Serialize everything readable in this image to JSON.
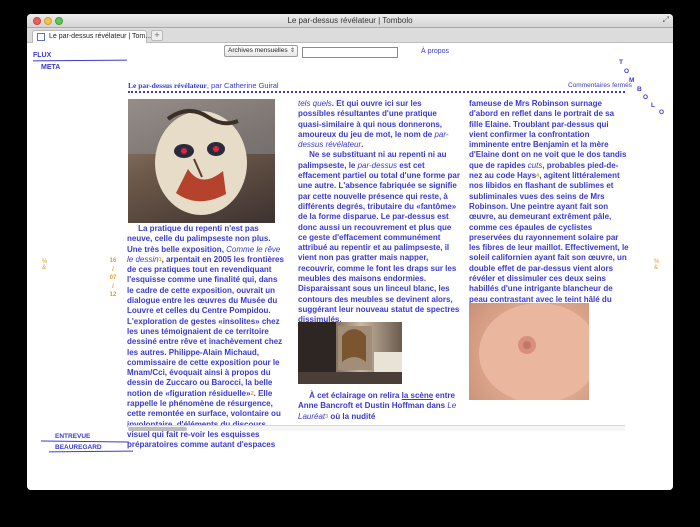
{
  "window": {
    "title": "Le par-dessus révélateur | Tombolo"
  },
  "tabs": [
    {
      "label": "Le par-dessus révélateur | Tom..."
    }
  ],
  "nav": {
    "flux": "FLUX",
    "meta": "META",
    "entrevue": "ENTREVUE",
    "beauregard": "BEAUREGARD"
  },
  "toolbar": {
    "archive_label": "Archives mensuelles",
    "search_placeholder": "",
    "apropos": "À propos"
  },
  "logo": {
    "letters": [
      "T",
      "O",
      "M",
      "B",
      "O",
      "L",
      "O"
    ]
  },
  "post": {
    "headline": "Le par-dessus révélateur",
    "byline_prefix": ", par ",
    "author": "Catherine Guiral",
    "comments": "Commentaires fermés",
    "date": [
      "16",
      "/",
      "07",
      "/",
      "12"
    ]
  },
  "text": {
    "c1_a": "La pratique du repenti n'est pas neuve, celle du palimpseste non plus. Une très belle exposition, ",
    "c1_em1": "Comme le rêve le dessin",
    "c1_fn1": "1",
    "c1_b": ", arpentait en 2005 les frontières de ces pratiques tout en revendiquant l'esquisse comme une finalité qui, dans le cadre de cette exposition, ouvrait un dialogue entre les œuvres du Musée du Louvre et celles du Centre Pompidou. L'exploration de gestes «insolites» chez les unes témoignaient de ce territoire dessiné entre rêve et inachèvement chez les autres. Philippe-Alain Michaud, commissaire de cette exposition pour le Mnam/Cci, évoquait ainsi à propos du dessin de Zuccaro ou Barocci, la belle notion de «figuration résiduelle»",
    "c1_fn2": "2",
    "c1_c": ". Elle rappelle le phénomène de résurgence, cette remontée en surface, volontaire ou involontaire, d'éléments du discours visuel qui fait re-voir les esquisses préparatoires comme autant d'espaces",
    "c2_em1": "tels quels",
    "c2_a": ". Et qui ouvre ici sur les possibles résultantes d'une pratique quasi-similaire à qui nous donnerons, amoureux du jeu de mot, le nom de ",
    "c2_em2": "par-dessus révélateur",
    "c2_b": ".",
    "c2_c": "Ne se substituant ni au repenti ni au palimpseste, le ",
    "c2_em3": "par-dessus",
    "c2_d": " est cet effacement partiel ou total d'une forme par une autre. L'absence fabriquée se signifie par cette nouvelle présence qui reste, à différents degrés, tributaire du «fantôme» de la forme disparue. Le par-dessus est donc aussi un recouvrement et plus que ce geste d'effacement communément attribué au repentir et au palimpseste, il vient non pas gratter mais napper, recouvrir, comme le font les draps sur les meubles des maisons endormies. Disparaissant sous un linceul blanc, les contours des meubles se devinent alors, suggérant leur nouveau statut de spectres dissimulés.",
    "c2_e": "À cet éclairage on relira ",
    "c2_link1": "la scène",
    "c2_f": " entre Anne Bancroft et Dustin Hoffman dans ",
    "c2_em4": "Le Lauréat",
    "c2_fn3": "3",
    "c2_g": " où la nudité",
    "c3_a": "fameuse de Mrs Robinson surnage d'abord en reflet dans le portrait de sa fille Elaine. Troublant par-dessus qui vient confirmer la confrontation imminente entre Benjamin et la mère d'Elaine dont on ne voit que le dos tandis que de rapides ",
    "c3_em1": "cuts",
    "c3_b": ", probables pied-de-nez au code Hays",
    "c3_fn4": "4",
    "c3_c": ", agitent littéralement nos libidos en flashant de sublimes et subliminales vues des seins de Mrs Robinson. Une peintre ayant fait son œuvre, au demeurant extrêment pâle, comme ces épaules de cyclistes preservées du rayonnement solaire par les fibres de leur maillot. Effectivement, le soleil californien ayant fait son œuvre, un double effet de par-dessus vient alors révéler et dissimuler ces deux seins habillés d'une intrigante blancheur de peau contrastant avec le teint hâlé du reste du corps de Bancroft."
  },
  "colors": {
    "text": "#3a3ad2",
    "accent": "#e0a020"
  }
}
